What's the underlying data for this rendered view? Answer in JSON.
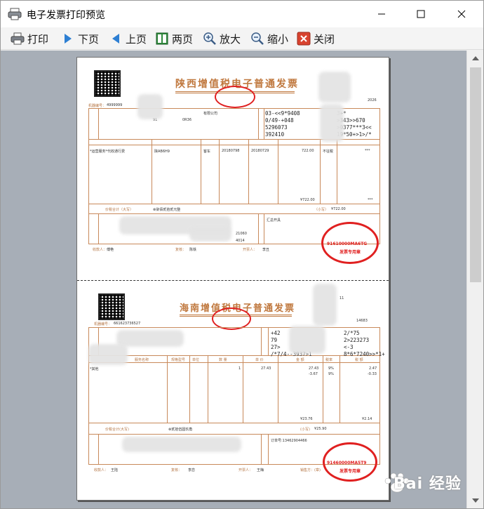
{
  "window": {
    "title": "电子发票打印预览"
  },
  "toolbar": {
    "print": "打印",
    "next": "下页",
    "prev": "上页",
    "two_pages": "两页",
    "zoom_in": "放大",
    "zoom_out": "缩小",
    "close": "关闭"
  },
  "invoice1": {
    "title": "陕西增值税电子普通发票",
    "machine_no_label": "机器编号：",
    "machine_no": "4999999",
    "invoice_date_suffix": "2026",
    "buyer_name_partial": "有限公司",
    "buyer_tax_partial": "91",
    "buyer_tax_partial2": "0R36",
    "cipher_lines": [
      "03-<<9*9408",
      "0/49-+048",
      "5296073",
      "392410"
    ],
    "cipher_right": [
      "3+*",
      ">343>>670",
      ">0377***3<<",
      "19*50+>1>/*"
    ],
    "col_goods": "*运营服务*代收通行费",
    "col_plate": "陕AB6H9",
    "col_type": "客车",
    "col_start": "20180798",
    "col_end": "20180729",
    "col_amount": "722.00",
    "col_rate": "不征税",
    "col_tax": "***",
    "subtotal_amount": "¥722.00",
    "subtotal_tax": "***",
    "total_label": "价税合计（大写）",
    "total_caps": "⊗柒佰贰拾贰元整",
    "total_small_label": "（小写）",
    "total_small": "¥722.00",
    "seller_tax_partial": "21060",
    "seller_addr_partial": "4014",
    "remarks": "汇总开具",
    "payee_label": "收款人：",
    "payee": "傅艳",
    "reviewer_label": "复核：",
    "reviewer": "陈铁",
    "drawer_label": "开票人：",
    "drawer": "李丑",
    "seal_code": "91610000MA6TG",
    "seal_label": "发票专用章"
  },
  "invoice2": {
    "title": "海南增值税电子普通发票",
    "machine_no_label": "机器编号：",
    "machine_no": "661623736527",
    "code_suffix": "11",
    "date_suffix": "14683",
    "cipher_lines": [
      "+42",
      "79",
      "27>",
      "/*7/4--3937>1"
    ],
    "cipher_right": [
      "2/*75",
      "2>223273",
      "<-3",
      "8*6*7240>>*1+"
    ],
    "goods_name": "*其他",
    "amount1": "27.43",
    "amount2": "-3.67",
    "rate1": "9%",
    "rate2": "9%",
    "tax1": "2.47",
    "tax2": "-0.33",
    "qty1": "1",
    "price1": "27.43",
    "subtotal_amount": "¥23.76",
    "subtotal_tax": "¥2.14",
    "total_label": "价税合计(大写)",
    "total_caps": "⊗贰拾伍圆玖角",
    "total_small_label": "(小写)",
    "total_small": "¥25.90",
    "order_no": "订单号:13462904466",
    "payee_label": "收款人：",
    "payee": "王陆",
    "reviewer_label": "复核：",
    "reviewer": "李恋",
    "drawer_label": "开票人：",
    "drawer": "王梅",
    "seller_label": "销售方：(章)",
    "seal_code": "91460000MA5T9",
    "seal_label": "发票专用章",
    "header_cols": [
      "服务名称",
      "规格型号",
      "单位",
      "数 量",
      "单 价",
      "金 额",
      "税率",
      "税 额"
    ]
  },
  "watermark": {
    "text": "Bai 经验"
  }
}
